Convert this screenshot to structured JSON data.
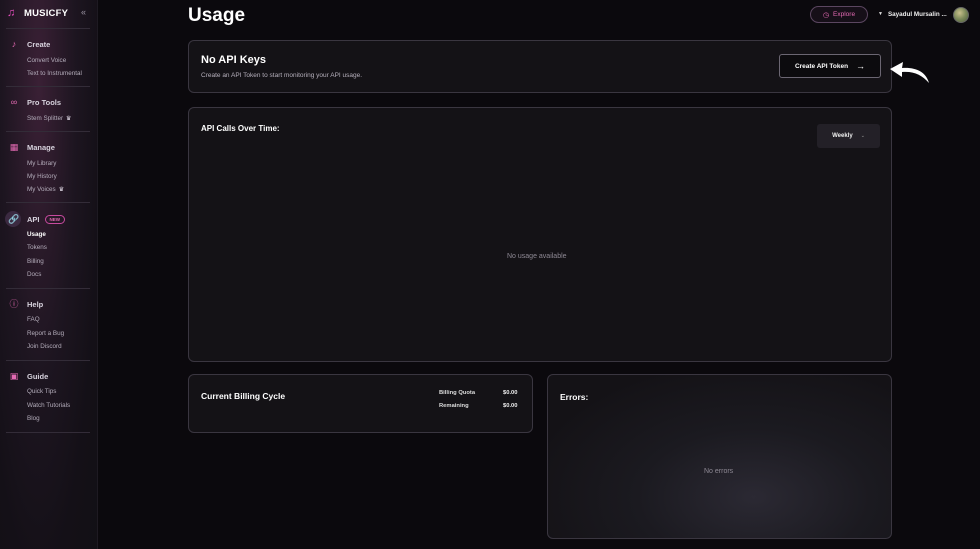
{
  "brand": {
    "name": "MUSICFY",
    "collapse_icon": "chevrons-left-icon"
  },
  "sidebar": {
    "create": {
      "label": "Create",
      "items": [
        "Convert Voice",
        "Text to Instrumental"
      ]
    },
    "pro_tools": {
      "label": "Pro Tools",
      "items": [
        "Stem Splitter"
      ]
    },
    "manage": {
      "label": "Manage",
      "items": [
        "My Library",
        "My History",
        "My Voices"
      ]
    },
    "api": {
      "label": "API",
      "badge": "NEW",
      "items": [
        "Usage",
        "Tokens",
        "Billing",
        "Docs"
      ],
      "active": "Usage"
    },
    "help": {
      "label": "Help",
      "items": [
        "FAQ",
        "Report a Bug",
        "Join Discord"
      ]
    },
    "guide": {
      "label": "Guide",
      "items": [
        "Quick Tips",
        "Watch Tutorials",
        "Blog"
      ]
    }
  },
  "header": {
    "title": "Usage",
    "explore_label": "Explore",
    "user_name": "Sayadul Mursalin ..."
  },
  "api_keys": {
    "title": "No API Keys",
    "description": "Create an API Token to start monitoring your API usage.",
    "button_label": "Create API Token"
  },
  "calls": {
    "title": "API Calls Over Time:",
    "period": "Weekly",
    "empty": "No usage available"
  },
  "billing": {
    "title": "Current Billing Cycle",
    "quota_label": "Billing Quota",
    "quota_value": "$0.00",
    "remaining_label": "Remaining",
    "remaining_value": "$0.00"
  },
  "errors": {
    "title": "Errors:",
    "empty": "No errors"
  },
  "colors": {
    "accent": "#e84fbf",
    "background": "#0b090d",
    "card": "#141216"
  }
}
